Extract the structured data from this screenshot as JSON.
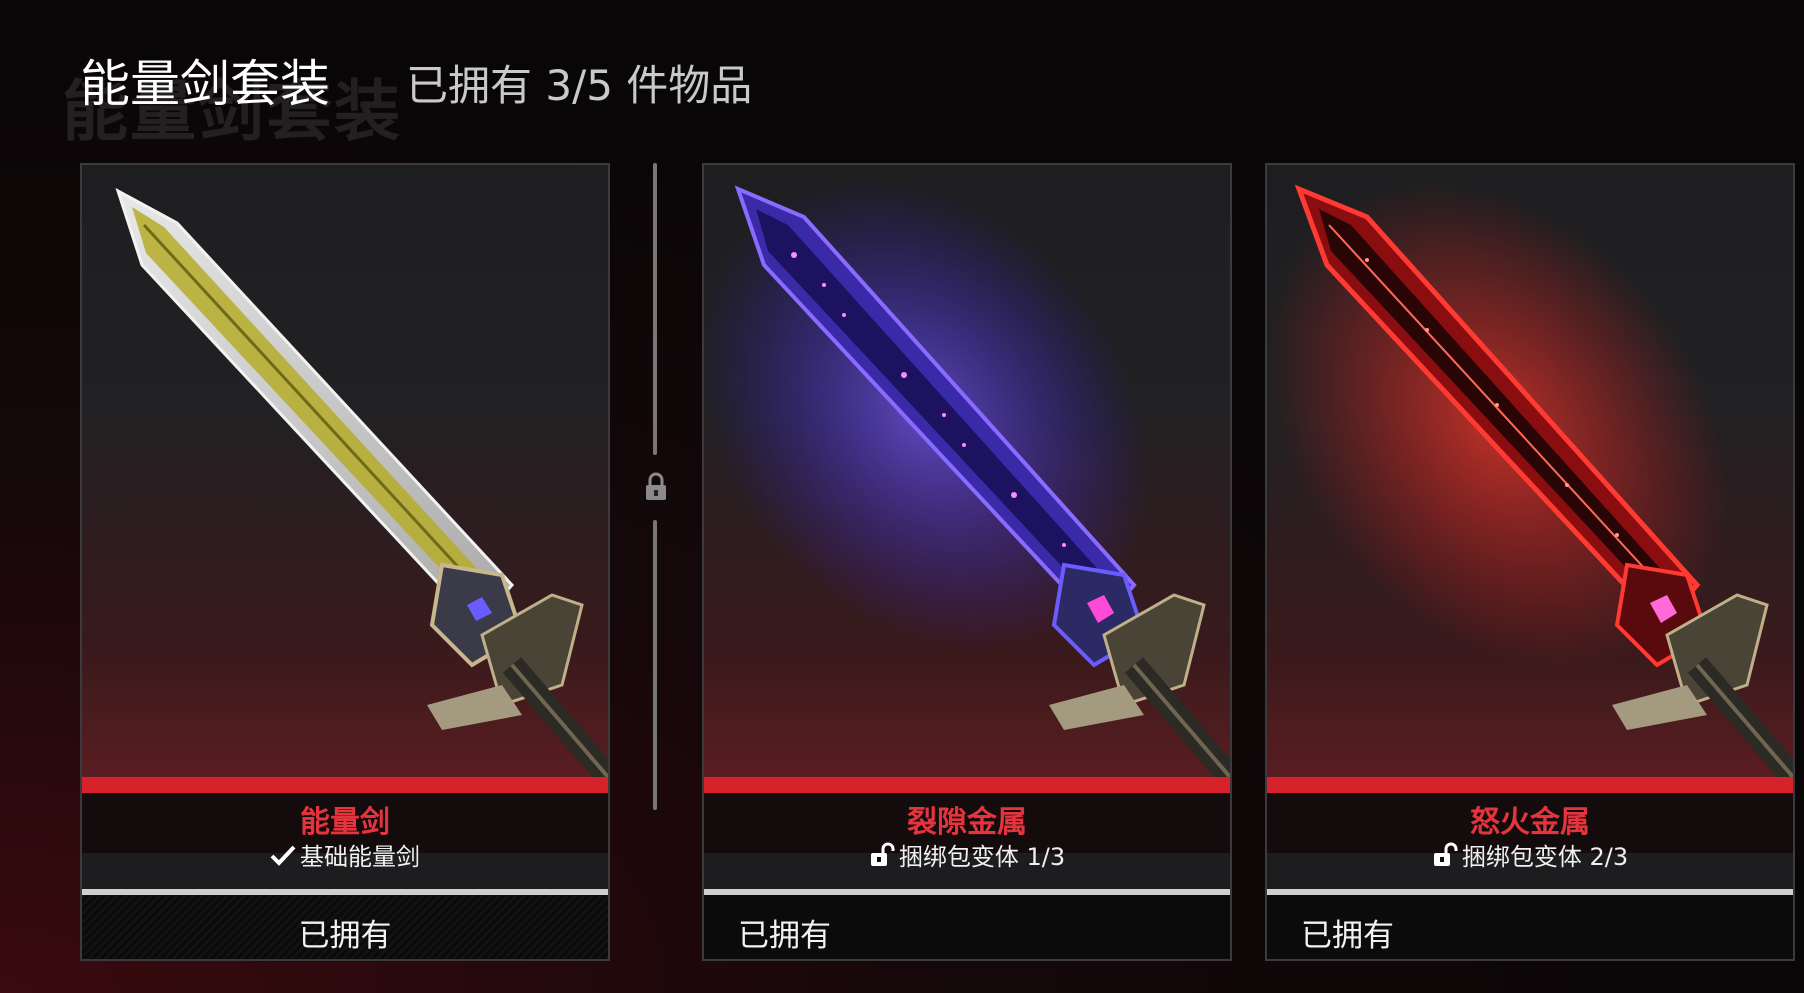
{
  "header": {
    "title": "能量剑套装",
    "ghost_title": "能量剑套装",
    "subtitle": "已拥有 3/5 件物品"
  },
  "cards": [
    {
      "name": "能量剑",
      "variant_icon": "check-icon",
      "variant_label": "基础能量剑",
      "status": "已拥有",
      "accent": "#e5343d",
      "glow": "#d8d8d8"
    },
    {
      "name": "裂隙金属",
      "variant_icon": "unlock-icon",
      "variant_label": "捆绑包变体 1/3",
      "status": "已拥有",
      "accent": "#e5343d",
      "glow": "#5a3cff"
    },
    {
      "name": "怒火金属",
      "variant_icon": "unlock-icon",
      "variant_label": "捆绑包变体 2/3",
      "status": "已拥有",
      "accent": "#e5343d",
      "glow": "#ff2a2a"
    }
  ],
  "colors": {
    "accent_red": "#d6222b",
    "name_red": "#e5343d",
    "background": "#070607"
  }
}
